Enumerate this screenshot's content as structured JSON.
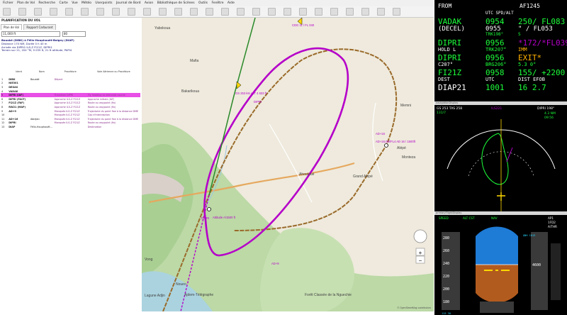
{
  "menubar": {
    "items": [
      "Fichier",
      "Plan de Vol",
      "Recherche",
      "Carte",
      "Vue",
      "Météo",
      "Userpoints",
      "Journal de Bord",
      "Avion",
      "Bibliothèque de Scènes",
      "Outils",
      "Fenêtre",
      "Aide"
    ]
  },
  "flightplan": {
    "panel_title": "PLANIFICATION DU VOL",
    "tabs": [
      "Plan de Vol",
      "Rapport Carburant"
    ],
    "search_value": "11,000 ft",
    "zoom_value": "80",
    "info": [
      "Bouaké (DIBK) à Félix-Houphouët-Boigny (DIAP)",
      "Distance 170 NM, Durée 0 h 40 m",
      "Arrivée via DIPRI1 ILS-Z FI21Z, DIPRI1",
      "Terrain sur 21, 204 °M, 9 035 ft, 21 ft altitude, PAPI4"
    ],
    "columns": [
      "Ident",
      "Nom",
      "Procédure",
      "Voie Aérienne ou Procédure"
    ],
    "rows": [
      {
        "n": "1",
        "ident": "DIBK",
        "name": "Bouaké",
        "proc": "Départ"
      },
      {
        "n": "2",
        "ident": "NIE301",
        "name": "",
        "proc": ""
      },
      {
        "n": "3",
        "ident": "DEGAS",
        "name": "",
        "proc": ""
      },
      {
        "n": "4",
        "ident": "VADAK",
        "name": "",
        "proc": ""
      },
      {
        "n": "5",
        "ident": "DIPRI (IAF)",
        "name": "",
        "proc": "Transition DIPRI",
        "desc": "Fly heading to intercept course"
      },
      {
        "n": "6",
        "ident": "DIPRI (FACF)",
        "name": "",
        "proc": "Approche ILS-Z FI21Z",
        "desc": "Approche initiale (IAF)"
      },
      {
        "n": "7",
        "ident": "FI21Z (FAF)",
        "name": "",
        "proc": "Approche ILS-Z FI21Z",
        "desc": "Route au waypoint (fix)"
      },
      {
        "n": "8",
        "ident": "RW21 (MAP)",
        "name": "",
        "proc": "Approche ILS-Z FI21Z",
        "desc": "Route au waypoint (fix)"
      },
      {
        "n": "9",
        "ident": "AD+9",
        "name": "",
        "proc": "Manquée ILS-Z FI21Z",
        "desc": "Trajectoire du point fixe à la distance DME"
      },
      {
        "n": "10",
        "ident": "",
        "name": "",
        "proc": "Manquée ILS-Z FI21Z",
        "desc": "Cap d'interception"
      },
      {
        "n": "11",
        "ident": "AD+16",
        "name": "Abidjan",
        "proc": "Manquée ILS-Z FI21Z",
        "desc": "Trajectoire du point fixe à la distance DME"
      },
      {
        "n": "12",
        "ident": "DIPRI",
        "name": "",
        "proc": "Manquée ILS-Z FI21Z",
        "desc": "Route au waypoint (fix)"
      },
      {
        "n": "13",
        "ident": "DIAP",
        "name": "Félix-Houphouët...",
        "proc": "",
        "desc": "Destination"
      }
    ]
  },
  "map": {
    "towns": [
      "Yabokoua",
      "Mafia",
      "Bakarikoua",
      "Memni",
      "Alépé",
      "Monteza",
      "Ahoutoué",
      "Grand Alépé",
      "Noueo",
      "Ajdem-Télégraphe",
      "Forêt Classée de la Nguechie",
      "Lagune Adjin",
      "Vong",
      "DIPRI",
      "DIPRI",
      "AD+16",
      "AD+9"
    ],
    "aircraft_label": "CDG 11 / FL 040",
    "waypoint_labels": [
      "AD+16,0M/FL4 AD 16 / 1500ft",
      "GS 253 kts ALT 4 633 ft",
      "Attitude A/1500 ft"
    ],
    "attribution": "© OpenStreetMap contributors"
  },
  "mcdu": {
    "header": {
      "left": "FROM",
      "right": "AF1245",
      "sub": "UTC SPD/ALT"
    },
    "lines": [
      {
        "a": "VADAK",
        "b": "0954",
        "c": "250/ FL083"
      },
      {
        "a": "(DECEL)",
        "b": "0955",
        "c": "\" / FL053"
      },
      {
        "a": "",
        "b": "TRK198°",
        "c": "S"
      },
      {
        "a": "DIPRI",
        "b": "0956",
        "c": "*172/*FL039"
      },
      {
        "a": "HOLD L",
        "b": "TRK207°",
        "c": "IMM"
      },
      {
        "a": "DIPRI",
        "b": "0956",
        "c": "EXIT*"
      },
      {
        "a": "C207°",
        "b": "BRG206°",
        "c": "5.3 0°"
      },
      {
        "a": "FI21Z",
        "b": "0958",
        "c": "155/ +2200"
      },
      {
        "a": "DEST",
        "b": "UTC",
        "c": "DIST EFOB"
      },
      {
        "a": "DIAP21",
        "b": "1001",
        "c": "16 2.7"
      }
    ]
  },
  "nd": {
    "title": "navigationDisplay",
    "gs": "GS 253 TAS 258",
    "track": "131/7",
    "wpt": "DIPRI 198°",
    "dist": "4.3 NM",
    "eta": "09:56",
    "ils": "ILS221"
  },
  "pfd": {
    "title": "primaryFlightDisplay",
    "fma": [
      "SPEED",
      "ALT CST",
      "NAV",
      "AP1",
      "1FD2",
      "A/THR"
    ],
    "speeds": [
      "280",
      "260",
      "240",
      "220",
      "200",
      "180"
    ],
    "alt": "4600",
    "baro": "QNH 1013",
    "mach": "115 30"
  },
  "colors": {
    "magenta": "#b500c9",
    "route_brown": "#9a6b2b",
    "mcdu_green": "#1cff3a",
    "mcdu_cyan": "#26d7ff",
    "mcdu_amber": "#ffb000"
  }
}
